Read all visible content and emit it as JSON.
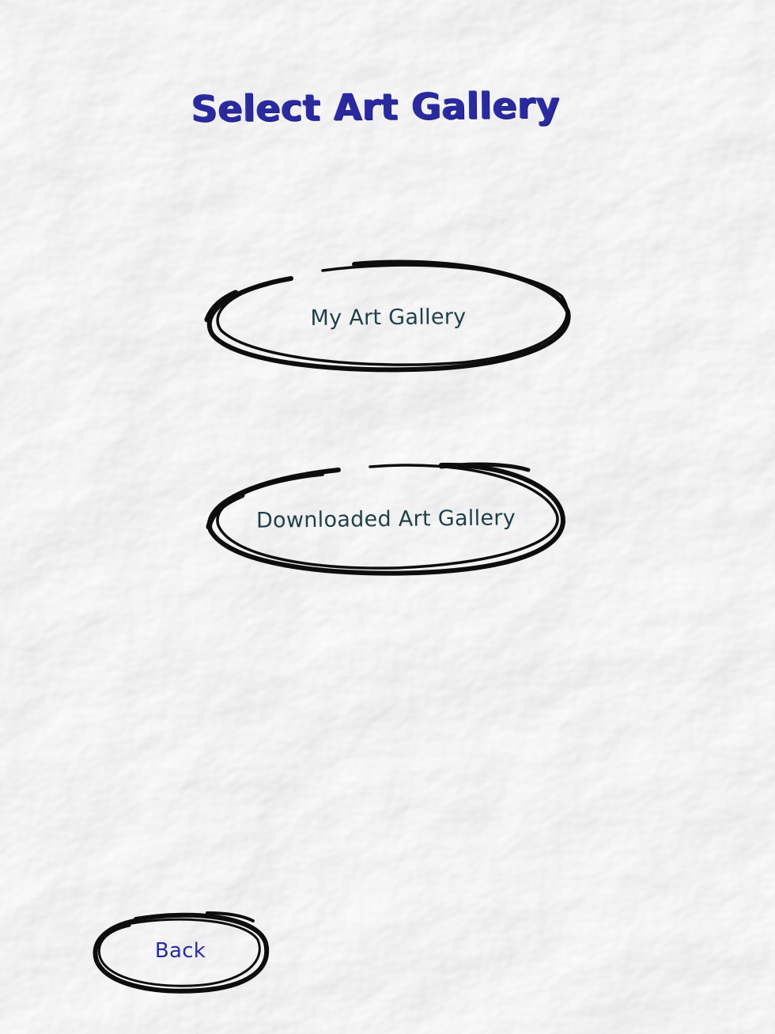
{
  "screen": {
    "title": "Select Art Gallery"
  },
  "buttons": {
    "my_gallery": "My Art Gallery",
    "downloaded_gallery": "Downloaded Art Gallery",
    "back": "Back"
  },
  "colors": {
    "title": "#2a2a9e",
    "button_text": "#1f3f47",
    "back_text": "#2a2a9e",
    "scribble": "#0d0d0d",
    "paper": "#ececec"
  },
  "icons": {
    "background": "crumpled-paper-texture",
    "button_outline": "scribbled-ellipse"
  }
}
